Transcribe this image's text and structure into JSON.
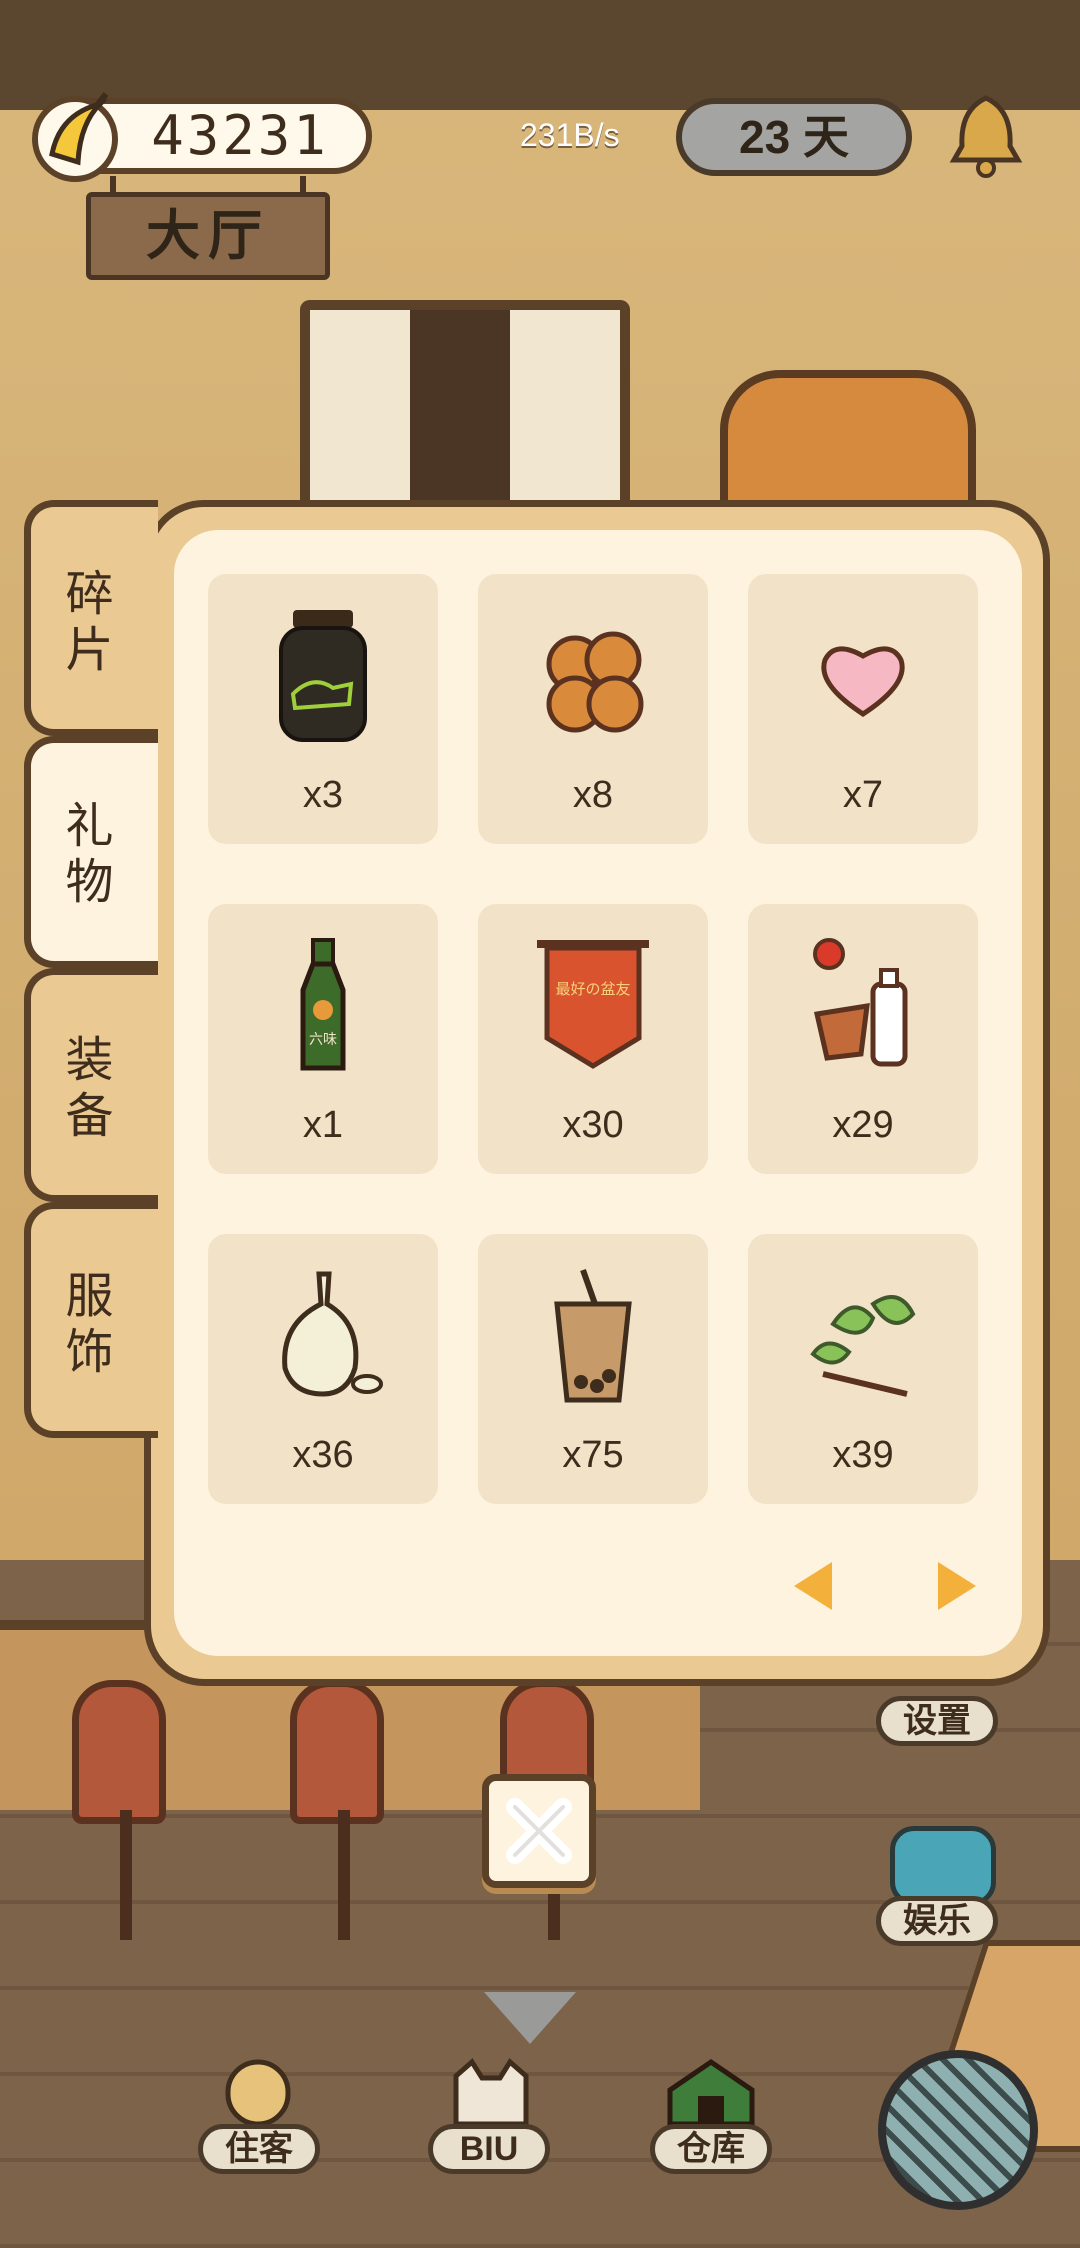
{
  "hud": {
    "coins": "43231",
    "rate": "231B/s",
    "days": "23 天"
  },
  "room": {
    "name": "大厅"
  },
  "panel": {
    "tabs": [
      {
        "label": "碎片",
        "active": false
      },
      {
        "label": "礼物",
        "active": true
      },
      {
        "label": "装备",
        "active": false
      },
      {
        "label": "服饰",
        "active": false
      }
    ],
    "items": [
      {
        "icon": "tonic-jar-icon",
        "count": "x3"
      },
      {
        "icon": "pastry-icon",
        "count": "x8"
      },
      {
        "icon": "heart-candy-icon",
        "count": "x7"
      },
      {
        "icon": "bottle-icon",
        "count": "x1"
      },
      {
        "icon": "banner-icon",
        "count": "x30"
      },
      {
        "icon": "flower-pot-water-icon",
        "count": "x29"
      },
      {
        "icon": "garlic-icon",
        "count": "x36"
      },
      {
        "icon": "bubble-tea-icon",
        "count": "x75"
      },
      {
        "icon": "herb-icon",
        "count": "x39"
      }
    ],
    "banner_text": "最好の盆友",
    "bottle_text": "六味"
  },
  "side": {
    "settings": "设置",
    "entertainment": "娱乐"
  },
  "nav": {
    "tenants": "住客",
    "biu": "BIU",
    "warehouse": "仓库"
  },
  "colors": {
    "accent_arrow": "#f3b13c",
    "panel_border": "#5b4128",
    "panel_bg": "#fdf3df"
  }
}
